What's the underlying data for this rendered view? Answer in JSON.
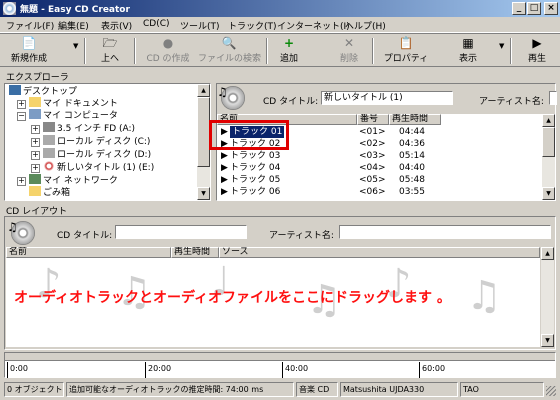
{
  "window": {
    "title": "無題 - Easy CD Creator",
    "minimize": "_",
    "maximize": "□",
    "close": "×"
  },
  "menu": [
    "ファイル(F)",
    "編集(E)",
    "表示(V)",
    "CD(C)",
    "ツール(T)",
    "トラック(T)",
    "インターネット(I)",
    "ヘルプ(H)"
  ],
  "toolbar": {
    "new": "新規作成",
    "up": "上へ",
    "cd_create": "CD の作成",
    "file_search": "ファイルの検索",
    "add": "追加",
    "delete": "削除",
    "properties": "プロパティ",
    "view": "表示",
    "play": "再生"
  },
  "explorer": {
    "label": "エクスプローラ",
    "tree": [
      "デスクトップ",
      "マイ ドキュメント",
      "マイ コンピュータ",
      "3.5 インチ FD (A:)",
      "ローカル ディスク (C:)",
      "ローカル ディスク (D:)",
      "新しいタイトル (1) (E:)",
      "マイ ネットワーク",
      "ごみ箱"
    ]
  },
  "cd_panel": {
    "title_label": "CD タイトル:",
    "title_value": "新しいタイトル (1)",
    "artist_label": "アーティスト名:",
    "columns": [
      "名前",
      "番号",
      "再生時間"
    ],
    "tracks": [
      {
        "name": "トラック 01",
        "num": "<01>",
        "time": "04:44"
      },
      {
        "name": "トラック 02",
        "num": "<02>",
        "time": "04:36"
      },
      {
        "name": "トラック 03",
        "num": "<03>",
        "time": "05:14"
      },
      {
        "name": "トラック 04",
        "num": "<04>",
        "time": "04:40"
      },
      {
        "name": "トラック 05",
        "num": "<05>",
        "time": "05:48"
      },
      {
        "name": "トラック 06",
        "num": "<06>",
        "time": "03:55"
      }
    ]
  },
  "layout": {
    "label": "CD レイアウト",
    "title_label": "CD タイトル:",
    "title_value": "",
    "artist_label": "アーティスト名:",
    "artist_value": "",
    "columns": [
      "名前",
      "再生時間",
      "ソース"
    ],
    "hint": "オーディオトラックとオーディオファイルをここにドラッグします 。"
  },
  "timeline": {
    "ticks": [
      "0:00",
      "20:00",
      "40:00",
      "60:00"
    ]
  },
  "status": {
    "objects": "0 オブジェクト",
    "estimate": "追加可能なオーディオトラックの推定時間: 74:00 ms",
    "type": "音楽 CD",
    "drive": "Matsushita UJDA330",
    "mode": "TAO"
  },
  "colors": {
    "highlight": "#0a246a",
    "annotation": "#e00000",
    "hint": "#ff1010"
  }
}
